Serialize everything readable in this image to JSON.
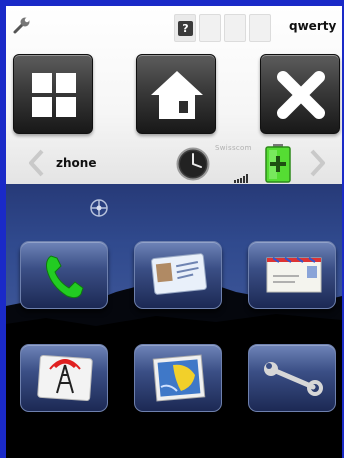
{
  "status_bar": {
    "settings_icon": "wrench-icon",
    "help_icon_glyph": "?",
    "keyboard_layout": "qwerty"
  },
  "toolbar": {
    "buttons": [
      {
        "icon": "grid-icon",
        "action": "menu"
      },
      {
        "icon": "home-icon",
        "action": "home"
      },
      {
        "icon": "close-icon",
        "action": "close"
      }
    ]
  },
  "info_bar": {
    "app_name": "zhone",
    "carrier": "Swisscom",
    "icons": [
      "chevron-left-icon",
      "clock-icon",
      "signal-icon",
      "battery-charging-icon",
      "chevron-right-icon"
    ]
  },
  "launcher": {
    "apps": [
      {
        "icon": "phone-icon"
      },
      {
        "icon": "contacts-icon"
      },
      {
        "icon": "mail-icon"
      },
      {
        "icon": "radio-tower-icon"
      },
      {
        "icon": "gallery-icon"
      },
      {
        "icon": "settings-wrench-icon"
      }
    ]
  },
  "colors": {
    "frame": "#1a2ac8",
    "phone_green": "#22cc22",
    "battery_green": "#55dd33",
    "radio_red": "#e02020"
  }
}
